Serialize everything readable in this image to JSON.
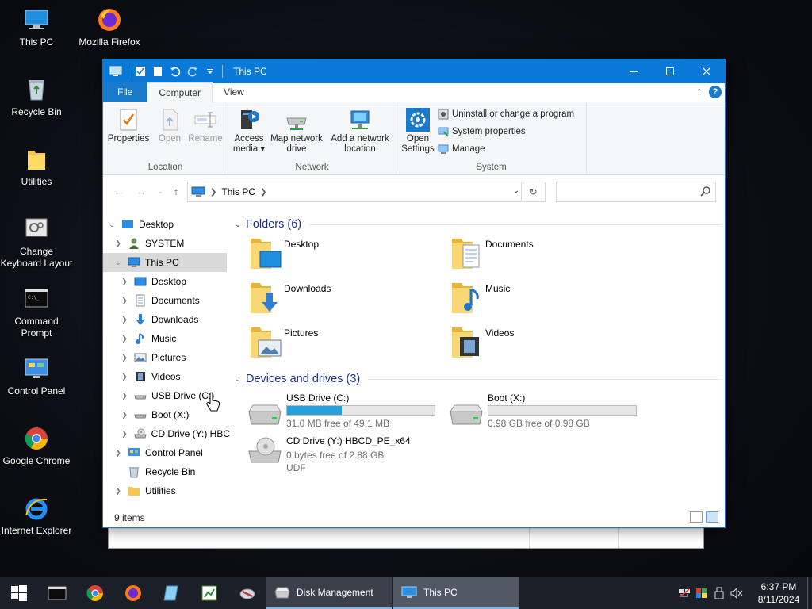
{
  "desktop": {
    "icons": [
      {
        "label": "This PC"
      },
      {
        "label": "Mozilla Firefox"
      },
      {
        "label": "Recycle Bin"
      },
      {
        "label": "Utilities"
      },
      {
        "label": "Change Keyboard Layout"
      },
      {
        "label": "Command Prompt"
      },
      {
        "label": "Control Panel"
      },
      {
        "label": "Google Chrome"
      },
      {
        "label": "Internet Explorer"
      }
    ]
  },
  "window": {
    "title": "This PC",
    "tabs": {
      "file": "File",
      "computer": "Computer",
      "view": "View"
    },
    "ribbon": {
      "location": {
        "label": "Location",
        "properties": "Properties",
        "open": "Open",
        "rename": "Rename"
      },
      "network": {
        "label": "Network",
        "access_media": "Access media",
        "map_drive": "Map network drive",
        "add_location": "Add a network location"
      },
      "system": {
        "label": "System",
        "open_settings": "Open Settings",
        "uninstall": "Uninstall or change a program",
        "system_properties": "System properties",
        "manage": "Manage"
      }
    },
    "address": {
      "crumb": "This PC",
      "search_placeholder": ""
    },
    "nav": [
      {
        "label": "Desktop",
        "icon": "folder-blue-icon"
      },
      {
        "label": "SYSTEM",
        "icon": "user-icon"
      },
      {
        "label": "This PC",
        "icon": "computer-icon"
      },
      {
        "label": "Desktop",
        "icon": "desktop-icon"
      },
      {
        "label": "Documents",
        "icon": "documents-icon"
      },
      {
        "label": "Downloads",
        "icon": "download-icon"
      },
      {
        "label": "Music",
        "icon": "music-icon"
      },
      {
        "label": "Pictures",
        "icon": "pictures-icon"
      },
      {
        "label": "Videos",
        "icon": "videos-icon"
      },
      {
        "label": "USB Drive (C:)",
        "icon": "drive-icon"
      },
      {
        "label": "Boot (X:)",
        "icon": "drive-icon"
      },
      {
        "label": "CD Drive (Y:) HBC",
        "icon": "cd-drive-icon"
      },
      {
        "label": "Control Panel",
        "icon": "control-panel-icon"
      },
      {
        "label": "Recycle Bin",
        "icon": "recycle-bin-icon"
      },
      {
        "label": "Utilities",
        "icon": "folder-icon"
      }
    ],
    "folders_header": "Folders (6)",
    "folders": [
      {
        "name": "Desktop"
      },
      {
        "name": "Documents"
      },
      {
        "name": "Downloads"
      },
      {
        "name": "Music"
      },
      {
        "name": "Pictures"
      },
      {
        "name": "Videos"
      }
    ],
    "drives_header": "Devices and drives (3)",
    "drives": [
      {
        "name": "USB Drive (C:)",
        "free_text": "31.0 MB free of 49.1 MB",
        "used_fraction": 0.37
      },
      {
        "name": "Boot (X:)",
        "free_text": "0.98 GB free of 0.98 GB",
        "used_fraction": 0.0
      },
      {
        "name": "CD Drive (Y:) HBCD_PE_x64",
        "free_text": "0 bytes free of 2.88 GB",
        "filesystem": "UDF"
      }
    ],
    "status": "9 items"
  },
  "taskbar": {
    "tasks": [
      {
        "label": "Disk Management"
      },
      {
        "label": "This PC"
      }
    ],
    "time": "6:37 PM",
    "date": "8/11/2024"
  },
  "colors": {
    "accent": "#0a78d7",
    "progress": "#26a0da",
    "section_header": "#1e3287"
  }
}
